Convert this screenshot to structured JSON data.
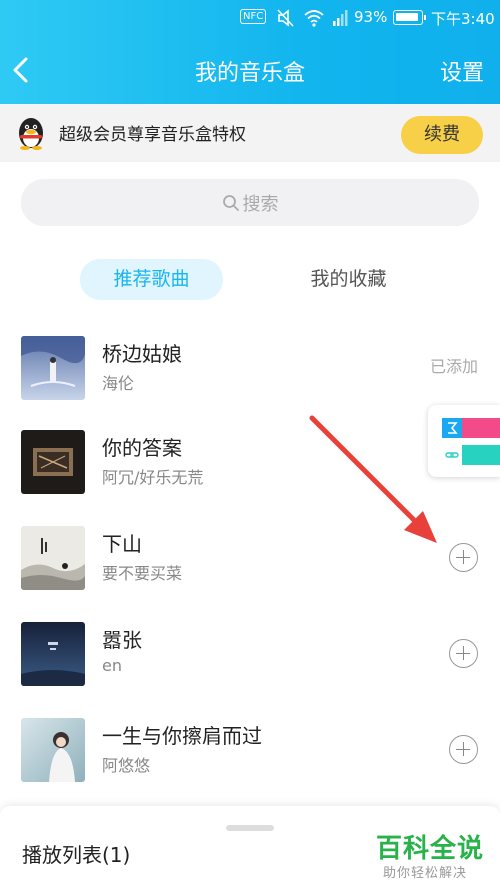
{
  "status_bar": {
    "nfc": "NFC",
    "battery": "93%",
    "time": "下午3:40"
  },
  "header": {
    "title": "我的音乐盒",
    "back_icon": "chevron-left-icon",
    "settings_label": "设置",
    "bg_color_start": "#2fcaf4",
    "bg_color_end": "#0fb0ec"
  },
  "vip": {
    "text": "超级会员尊享音乐盒特权",
    "icon": "qq-penguin-icon",
    "button_label": "续费",
    "button_color": "#f7d048"
  },
  "search": {
    "placeholder": "搜索",
    "icon": "search-icon"
  },
  "tabs": [
    {
      "label": "推荐歌曲",
      "active": true
    },
    {
      "label": "我的收藏",
      "active": false
    }
  ],
  "songs": [
    {
      "name": "桥边姑娘",
      "artist": "海伦",
      "status": "已添加"
    },
    {
      "name": "你的答案",
      "artist": "阿冗/好乐无荒",
      "status": ""
    },
    {
      "name": "下山",
      "artist": "要不要买菜",
      "status": "add"
    },
    {
      "name": "嚣张",
      "artist": "en",
      "status": "add"
    },
    {
      "name": "一生与你擦肩而过",
      "artist": "阿悠悠",
      "status": "add"
    }
  ],
  "bottom_bar": {
    "playlist_label": "播放列表(1)"
  },
  "watermark": {
    "title": "百科全说",
    "subtitle": "助你轻松解决"
  },
  "accent_color": "#19b5ef"
}
